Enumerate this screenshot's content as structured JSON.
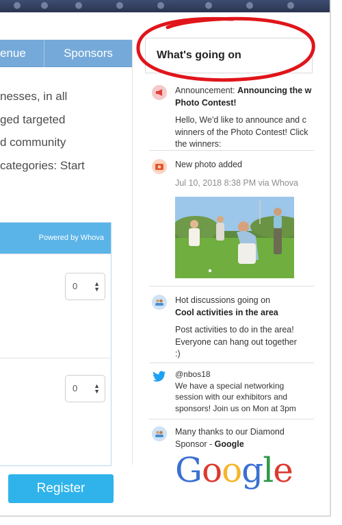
{
  "nav": {
    "tabs": [
      "enue",
      "Sponsors"
    ]
  },
  "intro": {
    "lines": [
      "nesses, in all",
      "ged targeted",
      "d community",
      "categories: Start"
    ]
  },
  "ticket": {
    "powered_by": "Powered by Whova",
    "rows": [
      {
        "quantity": "0"
      },
      {
        "quantity": "0"
      }
    ]
  },
  "register": {
    "label": "Register"
  },
  "feed": {
    "title": "What's going on",
    "items": [
      {
        "prefix": "Announcement: ",
        "title_bold": "Announcing the w",
        "title_bold_2": "Photo Contest!",
        "body": [
          "Hello, We'd like to announce and c",
          "winners of the Photo Contest! Click",
          "the winners:"
        ]
      },
      {
        "title": "New photo added",
        "meta": "Jul 10, 2018 8:38 PM via Whova"
      },
      {
        "title": "Hot discussions going on",
        "title_bold": "Cool activities in the area",
        "body": [
          "Post activities to do in the area!",
          "Everyone can hang out together",
          ":)"
        ]
      },
      {
        "handle": "@nbos18",
        "body": [
          "We have a special networking",
          "session with our exhibitors and",
          "sponsors!  Join us on Mon at 3pm"
        ]
      },
      {
        "title": "Many thanks to our Diamond",
        "title_2_prefix": "Sponsor - ",
        "title_2_bold": "Google",
        "logo_letters": [
          "G",
          "o",
          "o",
          "g",
          "l",
          "e"
        ]
      }
    ]
  },
  "colors": {
    "nav": "#75a9d9",
    "accent": "#2fb3ea",
    "ticket_head": "#5bb4e8",
    "highlight": "#e0151b"
  },
  "icons": [
    "announcement-icon",
    "photo-icon",
    "discussion-icon",
    "twitter-icon",
    "sponsor-icon",
    "stepper-arrows-icon"
  ]
}
